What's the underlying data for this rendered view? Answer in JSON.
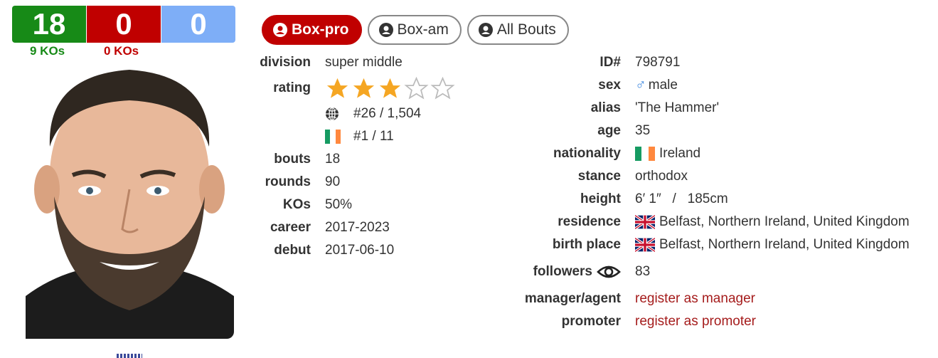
{
  "record": {
    "wins": "18",
    "losses": "0",
    "draws": "0",
    "win_kos": "9 KOs",
    "loss_kos": "0 KOs"
  },
  "tabs": [
    {
      "label": "Box-pro",
      "icon": "user-circle-icon",
      "active": true
    },
    {
      "label": "Box-am",
      "icon": "user-circle-icon",
      "active": false
    },
    {
      "label": "All Bouts",
      "icon": "user-circle-icon",
      "active": false
    }
  ],
  "left": {
    "division_label": "division",
    "division": "super middle",
    "rating_label": "rating",
    "rating_stars": 3,
    "rating_max": 5,
    "world_rank": "#26 / 1,504",
    "country_rank": "#1 / 11",
    "bouts_label": "bouts",
    "bouts": "18",
    "rounds_label": "rounds",
    "rounds": "90",
    "kos_label": "KOs",
    "kos": "50%",
    "career_label": "career",
    "career": "2017-2023",
    "debut_label": "debut",
    "debut": "2017-06-10"
  },
  "right": {
    "id_label": "ID#",
    "id": "798791",
    "sex_label": "sex",
    "sex": "male",
    "alias_label": "alias",
    "alias": "'The Hammer'",
    "age_label": "age",
    "age": "35",
    "nationality_label": "nationality",
    "nationality": "Ireland",
    "stance_label": "stance",
    "stance": "orthodox",
    "height_label": "height",
    "height": "6′ 1″   /   185cm",
    "residence_label": "residence",
    "residence": "Belfast, Northern Ireland, United Kingdom",
    "birth_place_label": "birth place",
    "birth_place": "Belfast, Northern Ireland, United Kingdom",
    "followers_label": "followers",
    "followers": "83",
    "manager_label": "manager/agent",
    "manager_link": "register as manager",
    "promoter_label": "promoter",
    "promoter_link": "register as promoter"
  },
  "colors": {
    "win": "#178a17",
    "loss": "#c00000",
    "draw": "#7eaef7",
    "star": "#f5a623",
    "link": "#a51c1c"
  }
}
